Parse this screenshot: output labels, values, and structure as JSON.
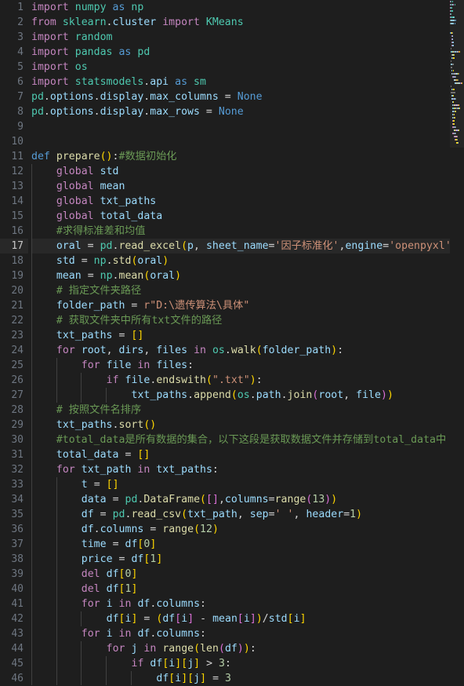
{
  "editor": {
    "language": "Python",
    "theme": "Dark Modern",
    "active_line": 17,
    "first_visible_line": 1,
    "last_visible_line": 46,
    "colors": {
      "background": "#1e1e1e",
      "active_line_background": "#282828",
      "line_number": "#6e7681",
      "line_number_active": "#c6c6c6",
      "indent_guide": "#404040",
      "keyword": "#c586c0",
      "declaration_keyword": "#569cd6",
      "function": "#dcdcaa",
      "variable": "#9cdcfe",
      "module": "#4ec9b0",
      "string": "#ce9178",
      "number": "#b5cea8",
      "comment": "#6a9955",
      "operator": "#d4d4d4",
      "bracket_level_1": "#ffd700",
      "bracket_level_2": "#da70d6",
      "bracket_level_3": "#179fff"
    }
  },
  "gutter": {
    "line_numbers": [
      1,
      2,
      3,
      4,
      5,
      6,
      7,
      8,
      9,
      10,
      11,
      12,
      13,
      14,
      15,
      16,
      17,
      18,
      19,
      20,
      21,
      22,
      23,
      24,
      25,
      26,
      27,
      28,
      29,
      30,
      31,
      32,
      33,
      34,
      35,
      36,
      37,
      38,
      39,
      40,
      41,
      42,
      43,
      44,
      45,
      46
    ]
  },
  "code": {
    "lines": [
      {
        "n": 1,
        "text": "import numpy as np"
      },
      {
        "n": 2,
        "text": "from sklearn.cluster import KMeans"
      },
      {
        "n": 3,
        "text": "import random"
      },
      {
        "n": 4,
        "text": "import pandas as pd"
      },
      {
        "n": 5,
        "text": "import os"
      },
      {
        "n": 6,
        "text": "import statsmodels.api as sm"
      },
      {
        "n": 7,
        "text": "pd.options.display.max_columns = None"
      },
      {
        "n": 8,
        "text": "pd.options.display.max_rows = None"
      },
      {
        "n": 9,
        "text": ""
      },
      {
        "n": 10,
        "text": ""
      },
      {
        "n": 11,
        "text": "def prepare():#数据初始化"
      },
      {
        "n": 12,
        "text": "    global std"
      },
      {
        "n": 13,
        "text": "    global mean"
      },
      {
        "n": 14,
        "text": "    global txt_paths"
      },
      {
        "n": 15,
        "text": "    global total_data"
      },
      {
        "n": 16,
        "text": "    #求得标准差和均值"
      },
      {
        "n": 17,
        "text": "    oral = pd.read_excel(p, sheet_name='因子标准化',engine='openpyxl')"
      },
      {
        "n": 18,
        "text": "    std = np.std(oral)"
      },
      {
        "n": 19,
        "text": "    mean = np.mean(oral)"
      },
      {
        "n": 20,
        "text": "    # 指定文件夹路径"
      },
      {
        "n": 21,
        "text": "    folder_path = r\"D:\\遗传算法\\具体\""
      },
      {
        "n": 22,
        "text": "    # 获取文件夹中所有txt文件的路径"
      },
      {
        "n": 23,
        "text": "    txt_paths = []"
      },
      {
        "n": 24,
        "text": "    for root, dirs, files in os.walk(folder_path):"
      },
      {
        "n": 25,
        "text": "        for file in files:"
      },
      {
        "n": 26,
        "text": "            if file.endswith(\".txt\"):"
      },
      {
        "n": 27,
        "text": "                txt_paths.append(os.path.join(root, file))"
      },
      {
        "n": 28,
        "text": "    # 按照文件名排序"
      },
      {
        "n": 29,
        "text": "    txt_paths.sort()"
      },
      {
        "n": 30,
        "text": "    #total_data是所有数据的集合,以下这段是获取数据文件并存储到total_data中"
      },
      {
        "n": 31,
        "text": "    total_data = []"
      },
      {
        "n": 32,
        "text": "    for txt_path in txt_paths:"
      },
      {
        "n": 33,
        "text": "        t = []"
      },
      {
        "n": 34,
        "text": "        data = pd.DataFrame([],columns=range(13))"
      },
      {
        "n": 35,
        "text": "        df = pd.read_csv(txt_path, sep=' ', header=1)"
      },
      {
        "n": 36,
        "text": "        df.columns = range(12)"
      },
      {
        "n": 37,
        "text": "        time = df[0]"
      },
      {
        "n": 38,
        "text": "        price = df[1]"
      },
      {
        "n": 39,
        "text": "        del df[0]"
      },
      {
        "n": 40,
        "text": "        del df[1]"
      },
      {
        "n": 41,
        "text": "        for i in df.columns:"
      },
      {
        "n": 42,
        "text": "            df[i] = (df[i] - mean[i])/std[i]"
      },
      {
        "n": 43,
        "text": "        for i in df.columns:"
      },
      {
        "n": 44,
        "text": "            for j in range(len(df)):"
      },
      {
        "n": 45,
        "text": "                if df[i][j] > 3:"
      },
      {
        "n": 46,
        "text": "                    df[i][j] = 3"
      }
    ]
  },
  "minimap": {
    "visible": true,
    "slider_top_line": 1,
    "slider_height_lines": 47
  }
}
